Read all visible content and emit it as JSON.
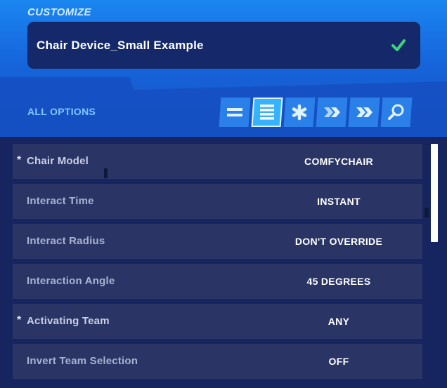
{
  "header": {
    "customize_label": "CUSTOMIZE",
    "device_name": "Chair Device_Small Example",
    "confirm_icon": "check-icon",
    "confirm_color": "#3ed37a"
  },
  "options_bar": {
    "title": "ALL OPTIONS",
    "tabs": [
      {
        "icon": "equals-icon",
        "active": false
      },
      {
        "icon": "list-icon",
        "active": true
      },
      {
        "icon": "asterisk-icon",
        "active": false
      },
      {
        "icon": "double-chevron-icon",
        "active": false
      },
      {
        "icon": "double-chevron-icon",
        "active": false
      },
      {
        "icon": "search-icon",
        "active": false
      }
    ]
  },
  "settings": [
    {
      "label": "Chair Model",
      "value": "COMFYCHAIR",
      "modified": true
    },
    {
      "label": "Interact Time",
      "value": "INSTANT",
      "modified": false
    },
    {
      "label": "Interact Radius",
      "value": "DON'T OVERRIDE",
      "modified": false
    },
    {
      "label": "Interaction Angle",
      "value": "45 DEGREES",
      "modified": false
    },
    {
      "label": "Activating Team",
      "value": "ANY",
      "modified": true
    },
    {
      "label": "Invert Team Selection",
      "value": "OFF",
      "modified": false
    }
  ],
  "modified_marker": "*",
  "colors": {
    "header_blue": "#1665db",
    "field_navy": "#15296a",
    "row_bg": "#2a3566",
    "accent_text": "#7fc8ff",
    "active_tab": "#36b3ff"
  }
}
